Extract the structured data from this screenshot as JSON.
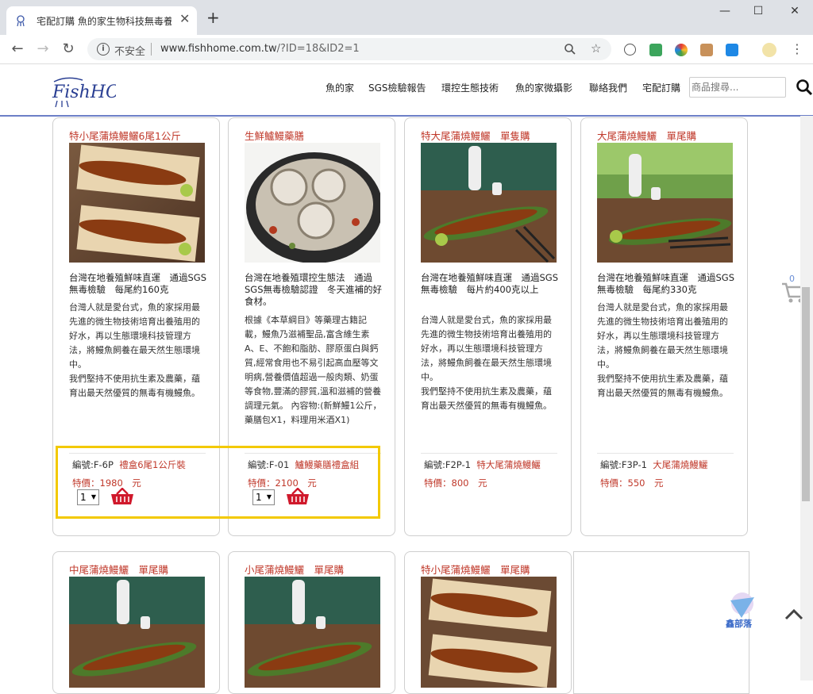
{
  "browser": {
    "tab_title": "宅配訂購 魚的家生物科技無毒養",
    "new_tab_label": "+",
    "tab_close": "✕",
    "window_controls": [
      "—",
      "☐",
      "✕"
    ],
    "security_label": "不安全",
    "url_domain": "www.fishhome.com.tw",
    "url_path": "/?ID=18&ID2=1",
    "extension_icons": [
      "puzzle-icon",
      "mail-icon",
      "color-icon",
      "face-icon",
      "sync-icon",
      "avatar-icon"
    ]
  },
  "site": {
    "logo_text": "FishHOME",
    "nav": [
      "魚的家",
      "SGS檢驗報告",
      "環控生態技術",
      "魚的家微攝影",
      "聯絡我們",
      "宅配訂購"
    ],
    "search_placeholder": "商品搜尋..."
  },
  "cart": {
    "count": "0"
  },
  "products_row1": [
    {
      "title": "特小尾蒲燒鰻鱺6尾1公斤",
      "summary": "台灣在地養殖鮮味直運　通過SGS無毒檢驗　每尾約160克",
      "description": "台灣人就是愛台式，魚的家採用最先進的微生物技術培育出養殖用的好水，再以生態環境科技管理方法，將鰻魚飼養在最天然生態環境中。\n我們堅持不使用抗生素及農藥，蘊育出最天然優質的無毒有機鰻魚。",
      "code_label": "編號:F-6P",
      "code_name": "禮盒6尾1公斤裝",
      "price": "特價：1980　元",
      "qty": "1"
    },
    {
      "title": "生鮮鱸鰻藥膳",
      "summary": "台灣在地養殖環控生態法　通過SGS無毒檢驗認證　冬天進補的好食材。",
      "description": "根據《本草綱目》等藥理古籍記載，鰻魚乃滋補聖品,富含維生素A、E、不飽和脂肪、膠原蛋白與鈣質,經常食用也不易引起高血壓等文明病,營養價值超過一般肉類、奶蛋等食物,豐滿的膠質,溫和滋補的營養調理元氣。 內容物:(新鮮鰻1公斤，藥膳包X1，料理用米酒X1)",
      "code_label": "編號:F-01",
      "code_name": "鱸鰻藥膳禮盒組",
      "price": "特價：2100　元",
      "qty": "1"
    },
    {
      "title": "特大尾蒲燒鰻鱺　單隻購",
      "summary": "台灣在地養殖鮮味直運　通過SGS無毒檢驗　每片約400克以上",
      "description": "台灣人就是愛台式，魚的家採用最先進的微生物技術培育出養殖用的好水，再以生態環境科技管理方法，將鰻魚飼養在最天然生態環境中。\n我們堅持不使用抗生素及農藥，蘊育出最天然優質的無毒有機鰻魚。",
      "code_label": "編號:F2P-1",
      "code_name": "特大尾蒲燒鰻鱺",
      "price": "特價：800　元"
    },
    {
      "title": "大尾蒲燒鰻鱺　單尾購",
      "summary": "台灣在地養殖鮮味直運　通過SGS無毒檢驗　每尾約330克",
      "description": "台灣人就是愛台式，魚的家採用最先進的微生物技術培育出養殖用的好水，再以生態環境科技管理方法，將鰻魚飼養在最天然生態環境中。\n我們堅持不使用抗生素及農藥，蘊育出最天然優質的無毒有機鰻魚。",
      "code_label": "編號:F3P-1",
      "code_name": "大尾蒲燒鰻鱺",
      "price": "特價：550　元"
    }
  ],
  "products_row2": [
    {
      "title": "中尾蒲燒鰻鱺　單尾購"
    },
    {
      "title": "小尾蒲燒鰻鱺　單尾購"
    },
    {
      "title": "特小尾蒲燒鰻鱺　單尾購"
    }
  ],
  "watermark_text": "鑫部落",
  "colors": {
    "accent_red": "#c0392b",
    "highlight_yellow": "#f3c900",
    "header_rule": "#6d7fc7"
  }
}
